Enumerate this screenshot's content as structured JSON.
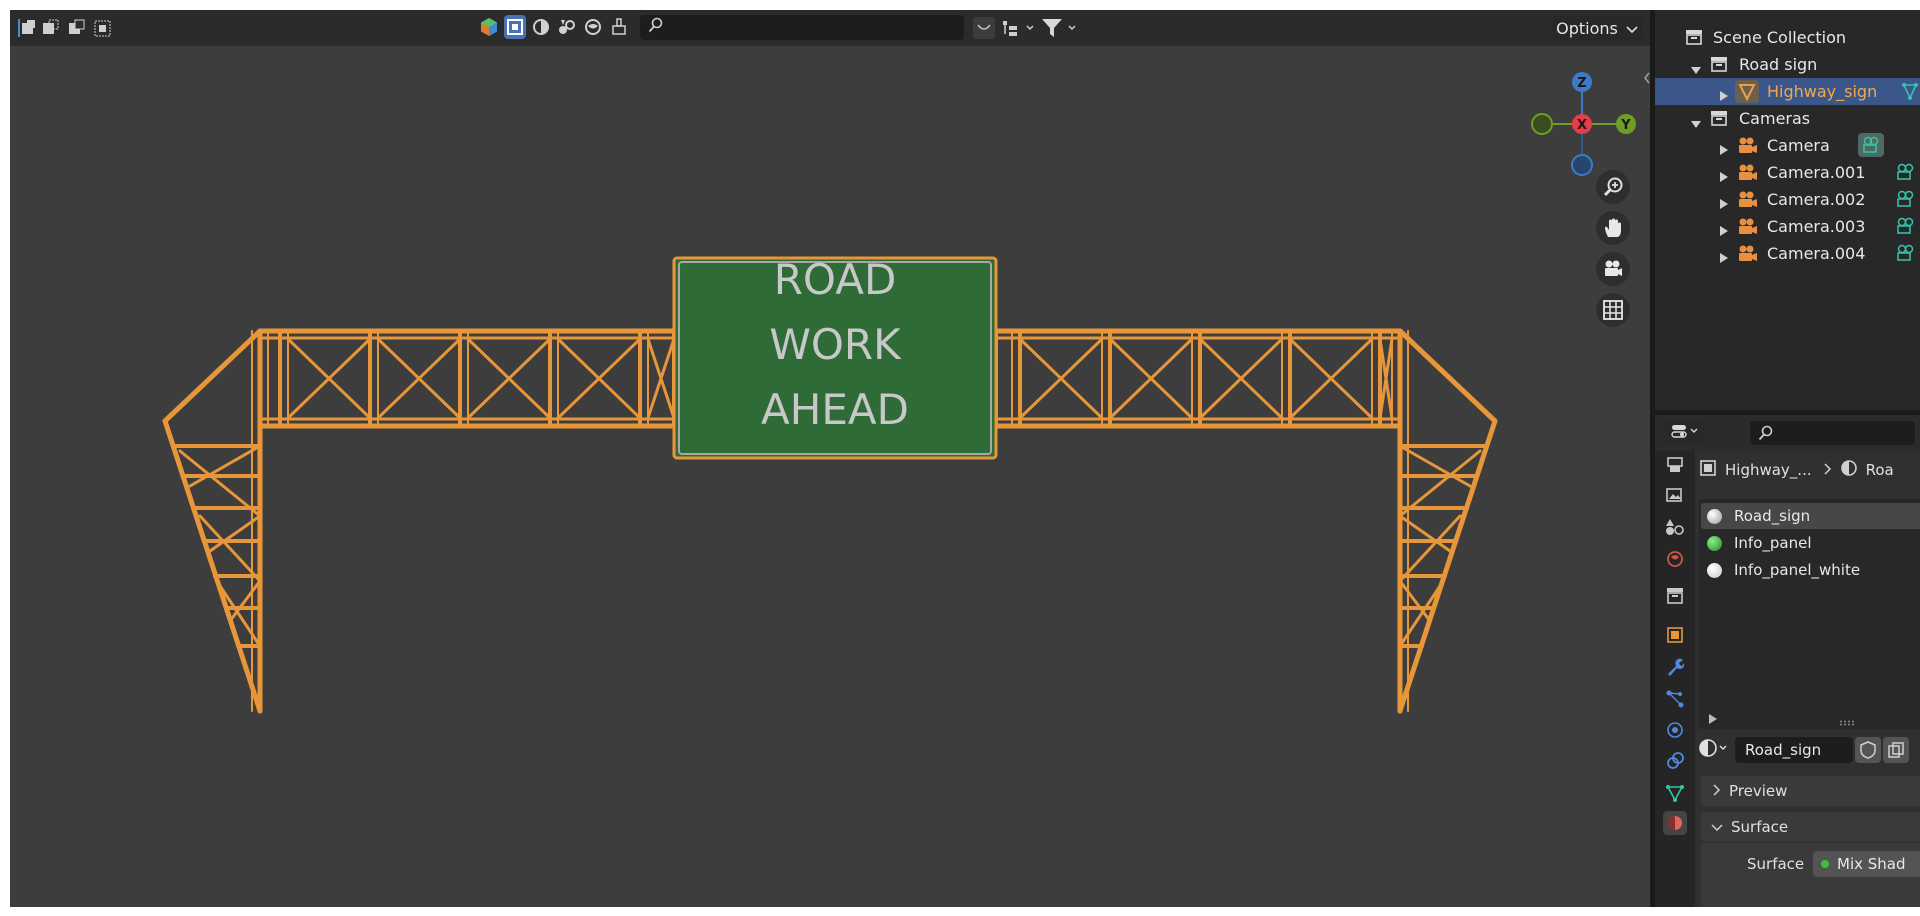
{
  "viewport": {
    "search_placeholder": "",
    "options_label": "Options",
    "sign_lines": [
      "ROAD",
      "WORK",
      "AHEAD"
    ],
    "gizmo": {
      "z": "Z",
      "x": "X",
      "y": "Y"
    },
    "colors": {
      "background": "#3d3d3d",
      "truss": "#e8963a",
      "sign_green": "#2e6b36",
      "sign_text": "#c8c8c8",
      "x_axis": "#e83a48",
      "y_axis": "#6e9e25",
      "z_axis": "#3e7ac8"
    }
  },
  "outliner": {
    "items": [
      {
        "label": "Scene Collection",
        "icon": "collection-icon",
        "depth": 0
      },
      {
        "label": "Road sign",
        "icon": "collection-icon",
        "depth": 1
      },
      {
        "label": "Highway_sign",
        "icon": "mesh-icon",
        "depth": 2,
        "selected": true
      },
      {
        "label": "Cameras",
        "icon": "collection-icon",
        "depth": 1
      },
      {
        "label": "Camera",
        "icon": "camera-icon",
        "depth": 2
      },
      {
        "label": "Camera.001",
        "icon": "camera-icon",
        "depth": 2
      },
      {
        "label": "Camera.002",
        "icon": "camera-icon",
        "depth": 2
      },
      {
        "label": "Camera.003",
        "icon": "camera-icon",
        "depth": 2
      },
      {
        "label": "Camera.004",
        "icon": "camera-icon",
        "depth": 2
      }
    ]
  },
  "properties": {
    "breadcrumb_object": "Highway_...",
    "breadcrumb_material": "Roa",
    "material_slots": [
      {
        "label": "Road_sign",
        "color": "#cfcfcf"
      },
      {
        "label": "Info_panel",
        "color": "#2fb52f"
      },
      {
        "label": "Info_panel_white",
        "color": "#f2f2f2"
      }
    ],
    "material_name": "Road_sign",
    "preview_label": "Preview",
    "surface_label": "Surface",
    "surface_field_label": "Surface",
    "surface_value": "Mix Shad"
  }
}
